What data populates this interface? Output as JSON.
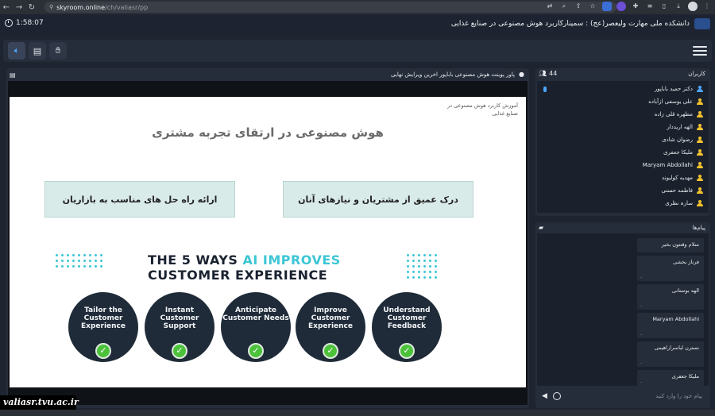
{
  "browser": {
    "url_host": "skyroom.online",
    "url_path": "/ch/valiasr/pp"
  },
  "header": {
    "timer": "1:58:07",
    "room_title": "دانشکده ملی مهارت ولیعصر(عج) : سمینارکاربرد هوش مصنوعی در صنایع غذایی"
  },
  "presentation": {
    "panel_title": "پاور پوینت هوش مصنوعی باباپور اخرین ویرایش نهایی",
    "slide": {
      "small_text": "آموزش کاربرد هوش مصنوعی در صنایع غذایی",
      "title": "هوش مصنوعی در ارتقای تجربه مشتری",
      "box_left": "ارائه راه حل های مناسب به بازاریان",
      "box_right": "درک عمیق از مشتریان و نیازهای آنان",
      "heading_line1_a": "THE 5 WAYS ",
      "heading_line1_b": "AI IMPROVES",
      "heading_line2": "CUSTOMER EXPERIENCE",
      "ways": [
        "Tailor the Customer Experience",
        "Instant Customer Support",
        "Anticipate Customer Needs",
        "Improve Customer Experience",
        "Understand Customer Feedback"
      ]
    }
  },
  "users": {
    "label": "کاربران",
    "count": "44",
    "list": [
      {
        "name": "دکتر حمید باباپور",
        "color": "#4ea6ff"
      },
      {
        "name": "علی یوسفی ازآباده",
        "color": "#f2c230"
      },
      {
        "name": "مطهره قلی زاده",
        "color": "#f2c230"
      },
      {
        "name": "الهه اریددار",
        "color": "#f2c230"
      },
      {
        "name": "رضوان شادی",
        "color": "#f2c230"
      },
      {
        "name": "ملیکا جعفری",
        "color": "#f2c230"
      },
      {
        "name": "Maryam Abdollahi",
        "color": "#f2c230"
      },
      {
        "name": "مهدیه کولیوند",
        "color": "#f2c230"
      },
      {
        "name": "فاطمه حسنی",
        "color": "#f2c230"
      },
      {
        "name": "سارہ نظری",
        "color": "#f2c230"
      }
    ]
  },
  "messages": {
    "label": "پیام‌ها",
    "items": [
      {
        "sender": "سلام وقتتون بخیر",
        "body": ""
      },
      {
        "sender": "فرناز بخشی",
        "body": "."
      },
      {
        "sender": "الهه بوستانی",
        "body": "."
      },
      {
        "sender": "Maryam Abdollahi",
        "body": "."
      },
      {
        "sender": "نسترن لباسراراهیمی",
        "body": "."
      },
      {
        "sender": "ملیکا جعفری",
        "body": "."
      }
    ],
    "input_placeholder": "پیام خود را وارد کنید"
  },
  "watermark": "valiasr.tvu.ac.ir"
}
